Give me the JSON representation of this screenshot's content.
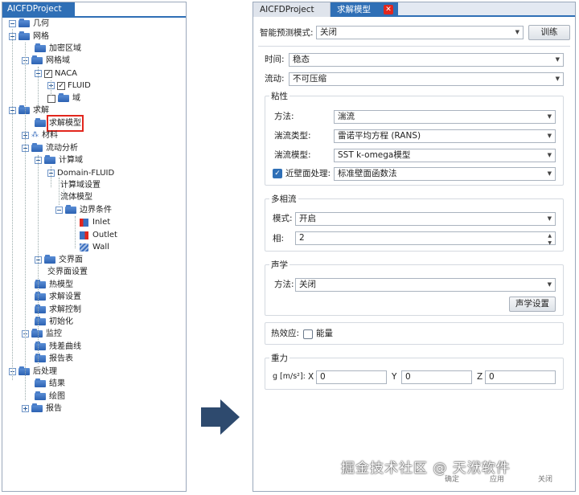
{
  "left_panel": {
    "tab_title": "AICFDProject",
    "tree": [
      {
        "label": "几何"
      },
      {
        "label": "网格"
      },
      {
        "label": "加密区域"
      },
      {
        "label": "网格域"
      },
      {
        "label": "NACA"
      },
      {
        "label": "FLUID"
      },
      {
        "label": "域"
      },
      {
        "label": "求解"
      },
      {
        "label": "求解模型"
      },
      {
        "label": "材料"
      },
      {
        "label": "流动分析"
      },
      {
        "label": "计算域"
      },
      {
        "label": "Domain-FLUID"
      },
      {
        "label": "计算域设置"
      },
      {
        "label": "流体模型"
      },
      {
        "label": "边界条件"
      },
      {
        "label": "Inlet"
      },
      {
        "label": "Outlet"
      },
      {
        "label": "Wall"
      },
      {
        "label": "交界面"
      },
      {
        "label": "交界面设置"
      },
      {
        "label": "热模型"
      },
      {
        "label": "求解设置"
      },
      {
        "label": "求解控制"
      },
      {
        "label": "初始化"
      },
      {
        "label": "监控"
      },
      {
        "label": "残差曲线"
      },
      {
        "label": "报告表"
      },
      {
        "label": "后处理"
      },
      {
        "label": "结果"
      },
      {
        "label": "绘图"
      },
      {
        "label": "报告"
      }
    ]
  },
  "right_panel": {
    "tabs": {
      "project": "AICFDProject",
      "active": "求解模型",
      "close_symbol": "✕"
    },
    "smart_mode": {
      "label": "智能预测模式:",
      "value": "关闭",
      "train_button": "训练"
    },
    "time": {
      "label": "时间:",
      "value": "稳态"
    },
    "flow": {
      "label": "流动:",
      "value": "不可压缩"
    },
    "viscosity": {
      "title": "粘性",
      "method": {
        "label": "方法:",
        "value": "湍流"
      },
      "turb_type": {
        "label": "湍流类型:",
        "value": "雷诺平均方程 (RANS)"
      },
      "turb_model": {
        "label": "湍流模型:",
        "value": "SST k-omega模型"
      },
      "near_wall": {
        "label": "近壁面处理:",
        "value": "标准壁面函数法",
        "checked": true
      }
    },
    "multiphase": {
      "title": "多相流",
      "mode": {
        "label": "模式:",
        "value": "开启"
      },
      "phase": {
        "label": "相:",
        "value": "2"
      }
    },
    "acoustics": {
      "title": "声学",
      "method": {
        "label": "方法:",
        "value": "关闭"
      },
      "settings_button": "声学设置"
    },
    "thermal": {
      "label": "热效应:",
      "checkbox_label": "能量",
      "checked": false
    },
    "gravity": {
      "title": "重力",
      "label": "g [m/s²]:",
      "x_label": "X",
      "x_value": "0",
      "y_label": "Y",
      "y_value": "0",
      "z_label": "Z",
      "z_value": "0"
    },
    "footer_buttons": {
      "ok": "确定",
      "apply": "应用",
      "close": "关闭"
    }
  },
  "watermark": "掘金技术社区 @ 天洑软件",
  "colors": {
    "accent": "#2f6fb6",
    "highlight_box": "#e2261d",
    "arrow": "#2e4a6e"
  }
}
